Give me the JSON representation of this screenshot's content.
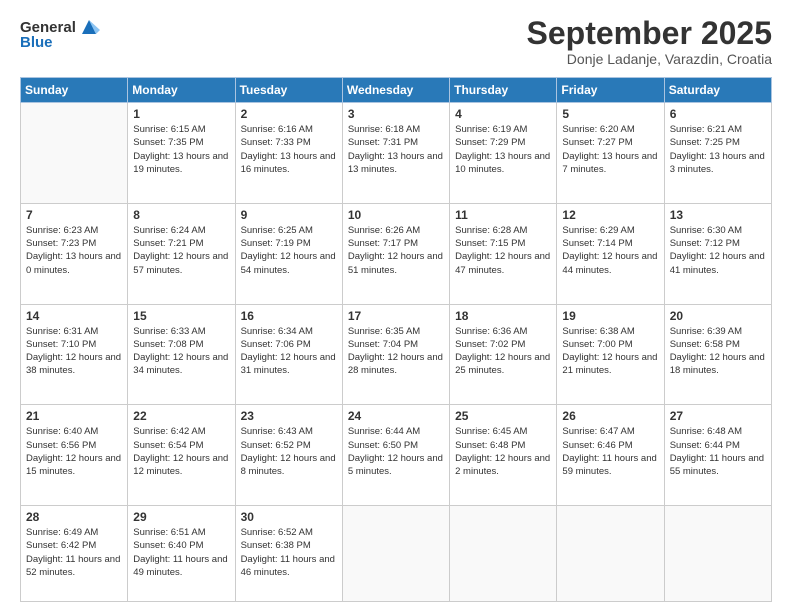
{
  "header": {
    "logo": {
      "general": "General",
      "blue": "Blue"
    },
    "title": "September 2025",
    "location": "Donje Ladanje, Varazdin, Croatia"
  },
  "calendar": {
    "days_of_week": [
      "Sunday",
      "Monday",
      "Tuesday",
      "Wednesday",
      "Thursday",
      "Friday",
      "Saturday"
    ],
    "weeks": [
      [
        {
          "day": "",
          "sunrise": "",
          "sunset": "",
          "daylight": ""
        },
        {
          "day": "1",
          "sunrise": "Sunrise: 6:15 AM",
          "sunset": "Sunset: 7:35 PM",
          "daylight": "Daylight: 13 hours and 19 minutes."
        },
        {
          "day": "2",
          "sunrise": "Sunrise: 6:16 AM",
          "sunset": "Sunset: 7:33 PM",
          "daylight": "Daylight: 13 hours and 16 minutes."
        },
        {
          "day": "3",
          "sunrise": "Sunrise: 6:18 AM",
          "sunset": "Sunset: 7:31 PM",
          "daylight": "Daylight: 13 hours and 13 minutes."
        },
        {
          "day": "4",
          "sunrise": "Sunrise: 6:19 AM",
          "sunset": "Sunset: 7:29 PM",
          "daylight": "Daylight: 13 hours and 10 minutes."
        },
        {
          "day": "5",
          "sunrise": "Sunrise: 6:20 AM",
          "sunset": "Sunset: 7:27 PM",
          "daylight": "Daylight: 13 hours and 7 minutes."
        },
        {
          "day": "6",
          "sunrise": "Sunrise: 6:21 AM",
          "sunset": "Sunset: 7:25 PM",
          "daylight": "Daylight: 13 hours and 3 minutes."
        }
      ],
      [
        {
          "day": "7",
          "sunrise": "Sunrise: 6:23 AM",
          "sunset": "Sunset: 7:23 PM",
          "daylight": "Daylight: 13 hours and 0 minutes."
        },
        {
          "day": "8",
          "sunrise": "Sunrise: 6:24 AM",
          "sunset": "Sunset: 7:21 PM",
          "daylight": "Daylight: 12 hours and 57 minutes."
        },
        {
          "day": "9",
          "sunrise": "Sunrise: 6:25 AM",
          "sunset": "Sunset: 7:19 PM",
          "daylight": "Daylight: 12 hours and 54 minutes."
        },
        {
          "day": "10",
          "sunrise": "Sunrise: 6:26 AM",
          "sunset": "Sunset: 7:17 PM",
          "daylight": "Daylight: 12 hours and 51 minutes."
        },
        {
          "day": "11",
          "sunrise": "Sunrise: 6:28 AM",
          "sunset": "Sunset: 7:15 PM",
          "daylight": "Daylight: 12 hours and 47 minutes."
        },
        {
          "day": "12",
          "sunrise": "Sunrise: 6:29 AM",
          "sunset": "Sunset: 7:14 PM",
          "daylight": "Daylight: 12 hours and 44 minutes."
        },
        {
          "day": "13",
          "sunrise": "Sunrise: 6:30 AM",
          "sunset": "Sunset: 7:12 PM",
          "daylight": "Daylight: 12 hours and 41 minutes."
        }
      ],
      [
        {
          "day": "14",
          "sunrise": "Sunrise: 6:31 AM",
          "sunset": "Sunset: 7:10 PM",
          "daylight": "Daylight: 12 hours and 38 minutes."
        },
        {
          "day": "15",
          "sunrise": "Sunrise: 6:33 AM",
          "sunset": "Sunset: 7:08 PM",
          "daylight": "Daylight: 12 hours and 34 minutes."
        },
        {
          "day": "16",
          "sunrise": "Sunrise: 6:34 AM",
          "sunset": "Sunset: 7:06 PM",
          "daylight": "Daylight: 12 hours and 31 minutes."
        },
        {
          "day": "17",
          "sunrise": "Sunrise: 6:35 AM",
          "sunset": "Sunset: 7:04 PM",
          "daylight": "Daylight: 12 hours and 28 minutes."
        },
        {
          "day": "18",
          "sunrise": "Sunrise: 6:36 AM",
          "sunset": "Sunset: 7:02 PM",
          "daylight": "Daylight: 12 hours and 25 minutes."
        },
        {
          "day": "19",
          "sunrise": "Sunrise: 6:38 AM",
          "sunset": "Sunset: 7:00 PM",
          "daylight": "Daylight: 12 hours and 21 minutes."
        },
        {
          "day": "20",
          "sunrise": "Sunrise: 6:39 AM",
          "sunset": "Sunset: 6:58 PM",
          "daylight": "Daylight: 12 hours and 18 minutes."
        }
      ],
      [
        {
          "day": "21",
          "sunrise": "Sunrise: 6:40 AM",
          "sunset": "Sunset: 6:56 PM",
          "daylight": "Daylight: 12 hours and 15 minutes."
        },
        {
          "day": "22",
          "sunrise": "Sunrise: 6:42 AM",
          "sunset": "Sunset: 6:54 PM",
          "daylight": "Daylight: 12 hours and 12 minutes."
        },
        {
          "day": "23",
          "sunrise": "Sunrise: 6:43 AM",
          "sunset": "Sunset: 6:52 PM",
          "daylight": "Daylight: 12 hours and 8 minutes."
        },
        {
          "day": "24",
          "sunrise": "Sunrise: 6:44 AM",
          "sunset": "Sunset: 6:50 PM",
          "daylight": "Daylight: 12 hours and 5 minutes."
        },
        {
          "day": "25",
          "sunrise": "Sunrise: 6:45 AM",
          "sunset": "Sunset: 6:48 PM",
          "daylight": "Daylight: 12 hours and 2 minutes."
        },
        {
          "day": "26",
          "sunrise": "Sunrise: 6:47 AM",
          "sunset": "Sunset: 6:46 PM",
          "daylight": "Daylight: 11 hours and 59 minutes."
        },
        {
          "day": "27",
          "sunrise": "Sunrise: 6:48 AM",
          "sunset": "Sunset: 6:44 PM",
          "daylight": "Daylight: 11 hours and 55 minutes."
        }
      ],
      [
        {
          "day": "28",
          "sunrise": "Sunrise: 6:49 AM",
          "sunset": "Sunset: 6:42 PM",
          "daylight": "Daylight: 11 hours and 52 minutes."
        },
        {
          "day": "29",
          "sunrise": "Sunrise: 6:51 AM",
          "sunset": "Sunset: 6:40 PM",
          "daylight": "Daylight: 11 hours and 49 minutes."
        },
        {
          "day": "30",
          "sunrise": "Sunrise: 6:52 AM",
          "sunset": "Sunset: 6:38 PM",
          "daylight": "Daylight: 11 hours and 46 minutes."
        },
        {
          "day": "",
          "sunrise": "",
          "sunset": "",
          "daylight": ""
        },
        {
          "day": "",
          "sunrise": "",
          "sunset": "",
          "daylight": ""
        },
        {
          "day": "",
          "sunrise": "",
          "sunset": "",
          "daylight": ""
        },
        {
          "day": "",
          "sunrise": "",
          "sunset": "",
          "daylight": ""
        }
      ]
    ]
  }
}
